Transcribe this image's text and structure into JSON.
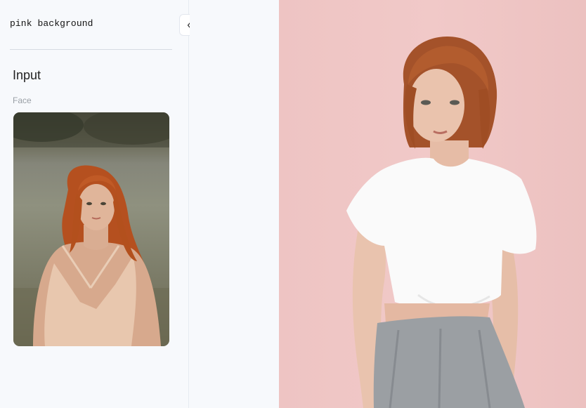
{
  "sidebar": {
    "prompt": "pink background",
    "section_title": "Input",
    "face_label": "Face",
    "face_image_desc": "",
    "collapse_icon": "chevrons-left-icon"
  },
  "result": {
    "image_desc": ""
  },
  "colors": {
    "sidebar_bg": "#f7f9fc",
    "result_bg": "#efc6c5"
  }
}
